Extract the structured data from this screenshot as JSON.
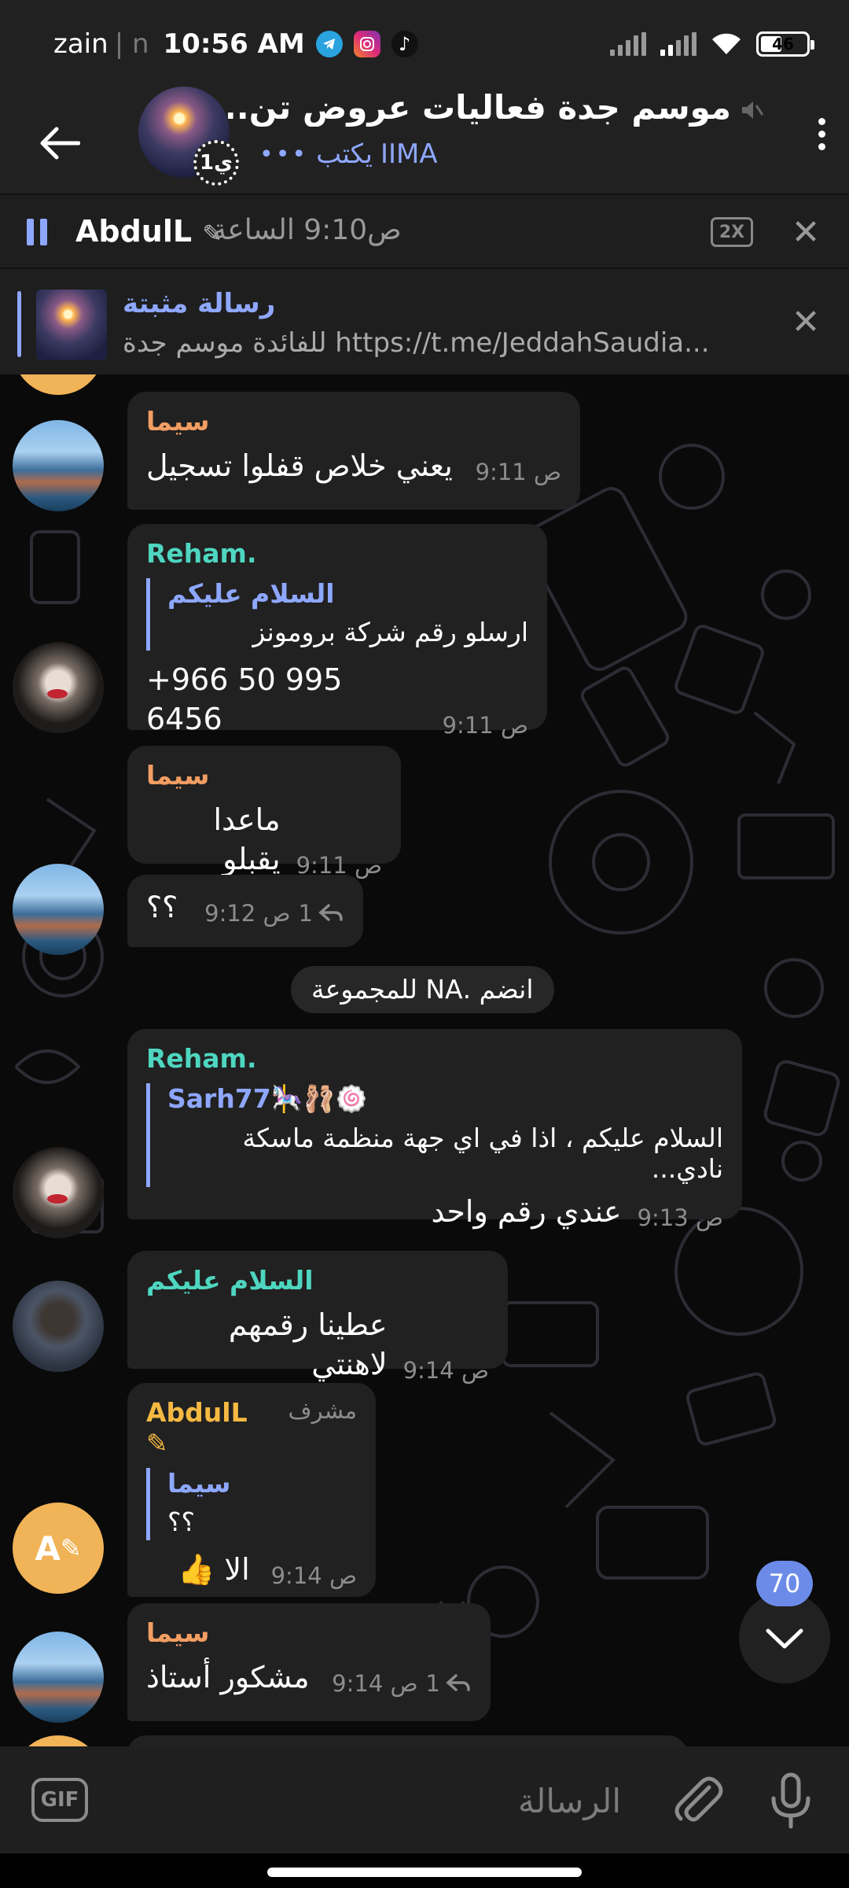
{
  "status_bar": {
    "carrier": "zain",
    "carrier_extra": "| n",
    "time": "10:56 AM",
    "battery": "46",
    "battery_level": 0.46
  },
  "header": {
    "title": "موسم جدة فعاليات عروض تن...",
    "typing_user": "IIMA",
    "typing_text": "يكتب",
    "timer_badge": "1ي"
  },
  "player": {
    "name": "AbdulL",
    "time": "ص9:10 الساعة",
    "speed": "2X"
  },
  "pinned": {
    "title": "رسالة مثبتة",
    "text": "للفائدة  موسم جدة https://t.me/JeddahSaudia..."
  },
  "messages": [
    {
      "sender": "سيما",
      "text": "يعني خلاص قفلوا تسجيل",
      "time": "9:11 ص"
    },
    {
      "sender": "Reham.",
      "quote_name": "السلام عليكم",
      "quote_text": "ارسلو رقم شركة برومونز",
      "text": "+966 50 995 6456",
      "time": "9:11 ص"
    },
    {
      "sender": "سيما",
      "text": "ماعدا يقبلو",
      "time": "9:11 ص"
    },
    {
      "sender": "",
      "text": "؟؟",
      "time": "9:12 ص",
      "replies": "1"
    },
    {
      "sender": "Reham.",
      "quote_name": "Sarh77🎠🩰🍥",
      "quote_text": "السلام عليكم ، اذا في اي جهة منظمة ماسكة نادي...",
      "text": "عندي رقم واحد",
      "time": "9:13 ص"
    },
    {
      "sender": "السلام عليكم",
      "text": "عطينا رقمهم لاهنتي",
      "time": "9:14 ص"
    },
    {
      "sender": "AbdulL",
      "role": "مشرف",
      "quote_name": "سيما",
      "quote_text": "؟؟",
      "text": "الا 👍",
      "time": "9:14 ص",
      "avatar": "A"
    },
    {
      "sender": "سيما",
      "text": "مشكور أستاذ",
      "time": "9:14 ص",
      "replies": "1"
    }
  ],
  "service_message": "انضم .NA للمجموعة",
  "unread_count": "70",
  "input": {
    "placeholder": "الرسالة",
    "gif_label": "GIF"
  },
  "colors": {
    "accent": "#8ea7ff",
    "bubble": "#212121",
    "sima_name": "#f29d62",
    "reham_name": "#4ed6c0",
    "admin_name": "#f5b942",
    "badge": "#6c8be9"
  }
}
